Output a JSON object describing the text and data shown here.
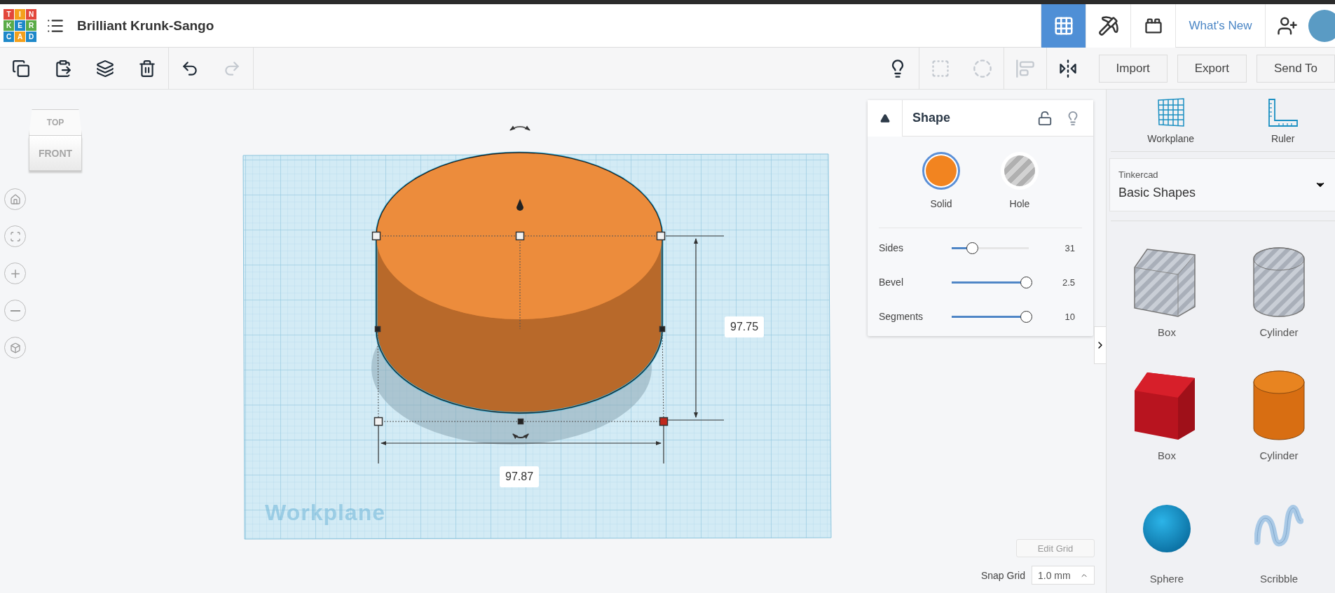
{
  "header": {
    "logo_letters": [
      {
        "text": "T",
        "color": "#e2473b"
      },
      {
        "text": "I",
        "color": "#f4a01c"
      },
      {
        "text": "N",
        "color": "#e2473b"
      },
      {
        "text": "K",
        "color": "#5aab48"
      },
      {
        "text": "E",
        "color": "#1e88c9"
      },
      {
        "text": "R",
        "color": "#5aab48"
      },
      {
        "text": "C",
        "color": "#1e88c9"
      },
      {
        "text": "A",
        "color": "#f4a01c"
      },
      {
        "text": "D",
        "color": "#1e88c9"
      }
    ],
    "project_title": "Brilliant Krunk-Sango",
    "nav": [
      {
        "kind": "grid",
        "selected": true
      },
      {
        "kind": "pickaxe",
        "selected": false
      },
      {
        "kind": "bricks",
        "selected": false
      }
    ],
    "whats_new": "What's New"
  },
  "toolbar": {
    "edit_tools": [
      {
        "kind": "copy",
        "disabled": false
      },
      {
        "kind": "paste",
        "disabled": false
      },
      {
        "kind": "duplicate",
        "disabled": false
      },
      {
        "kind": "delete",
        "disabled": false
      },
      {
        "kind": "undo",
        "disabled": false
      },
      {
        "kind": "redo",
        "disabled": true
      }
    ],
    "view_tools": [
      {
        "kind": "bulb",
        "disabled": false
      },
      {
        "kind": "group",
        "disabled": true
      },
      {
        "kind": "ungroup",
        "disabled": true
      },
      {
        "kind": "align",
        "disabled": true
      },
      {
        "kind": "mirror",
        "disabled": false
      }
    ],
    "buttons": [
      "Import",
      "Export",
      "Send To"
    ]
  },
  "viewcube": {
    "top": "TOP",
    "front": "FRONT"
  },
  "view_controls": [
    {
      "kind": "home"
    },
    {
      "kind": "fit"
    },
    {
      "kind": "zoom-in"
    },
    {
      "kind": "zoom-out"
    },
    {
      "kind": "ortho"
    }
  ],
  "shape_panel": {
    "title": "Shape",
    "locked": false,
    "modes": [
      {
        "label": "Solid",
        "kind": "solid",
        "selected": true
      },
      {
        "label": "Hole",
        "kind": "hole",
        "selected": false
      }
    ],
    "params": [
      {
        "label": "Sides",
        "level": 0.26,
        "reading": "31"
      },
      {
        "label": "Bevel",
        "level": 0.96,
        "reading": "2.5"
      },
      {
        "label": "Segments",
        "level": 0.96,
        "reading": "10"
      }
    ]
  },
  "canvas": {
    "height_label": "97.75",
    "width_label": "97.87",
    "workplane_label": "Workplane"
  },
  "grid": {
    "edit_button": "Edit Grid",
    "snap_label": "Snap Grid",
    "snap_value": "1.0 mm"
  },
  "library": {
    "tools": [
      {
        "label": "Workplane",
        "kind": "workplane"
      },
      {
        "label": "Ruler",
        "kind": "ruler"
      }
    ],
    "category_group": "Tinkercad",
    "category": "Basic Shapes",
    "shapes": [
      {
        "label": "Box",
        "kind": "box-hole"
      },
      {
        "label": "Cylinder",
        "kind": "cylinder-hole"
      },
      {
        "label": "Box",
        "kind": "box"
      },
      {
        "label": "Cylinder",
        "kind": "cylinder"
      },
      {
        "label": "Sphere",
        "kind": "sphere"
      },
      {
        "label": "Scribble",
        "kind": "scribble"
      }
    ]
  }
}
